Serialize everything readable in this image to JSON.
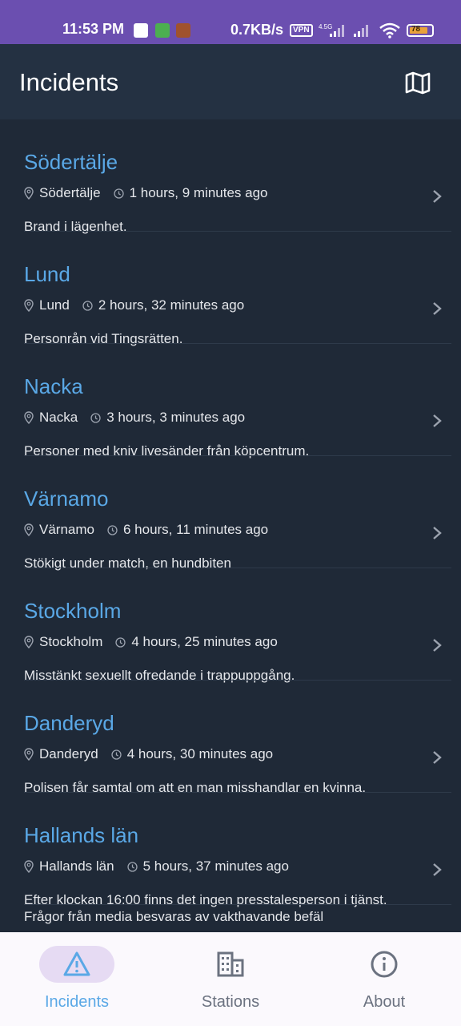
{
  "status_bar": {
    "time": "11:53 PM",
    "speed": "0.7KB/s",
    "vpn": "VPN",
    "network": "4.5G",
    "battery": "78"
  },
  "app_bar": {
    "title": "Incidents",
    "map_icon": "map-icon"
  },
  "incidents": [
    {
      "title": "Södertälje",
      "location": "Södertälje",
      "time": "1 hours, 9 minutes ago",
      "description": "Brand i lägenhet."
    },
    {
      "title": "Lund",
      "location": "Lund",
      "time": "2 hours, 32 minutes ago",
      "description": "Personrån vid Tingsrätten."
    },
    {
      "title": "Nacka",
      "location": "Nacka",
      "time": "3 hours, 3 minutes ago",
      "description": "Personer med kniv livesänder från köpcentrum."
    },
    {
      "title": "Värnamo",
      "location": "Värnamo",
      "time": "6 hours, 11 minutes ago",
      "description": "Stökigt under match, en hundbiten"
    },
    {
      "title": "Stockholm",
      "location": "Stockholm",
      "time": "4 hours, 25 minutes ago",
      "description": "Misstänkt sexuellt ofredande i trappuppgång."
    },
    {
      "title": "Danderyd",
      "location": "Danderyd",
      "time": "4 hours, 30 minutes ago",
      "description": "Polisen får samtal om att en man misshandlar en kvinna."
    },
    {
      "title": "Hallands län",
      "location": "Hallands län",
      "time": "5 hours, 37 minutes ago",
      "description": "Efter klockan 16:00 finns det ingen presstalesperson i tjänst. Frågor från media besvaras av vakthavande befäl"
    }
  ],
  "bottom_nav": [
    {
      "label": "Incidents",
      "icon": "warning-icon",
      "active": true
    },
    {
      "label": "Stations",
      "icon": "building-icon",
      "active": false
    },
    {
      "label": "About",
      "icon": "info-icon",
      "active": false
    }
  ],
  "colors": {
    "status_bar": "#6b4fb0",
    "app_bar": "#243142",
    "background": "#1f2937",
    "title_accent": "#5aa8e6",
    "nav_active": "#5aa8e6",
    "nav_inactive": "#6b7280",
    "nav_pill": "#e6dbf3"
  }
}
